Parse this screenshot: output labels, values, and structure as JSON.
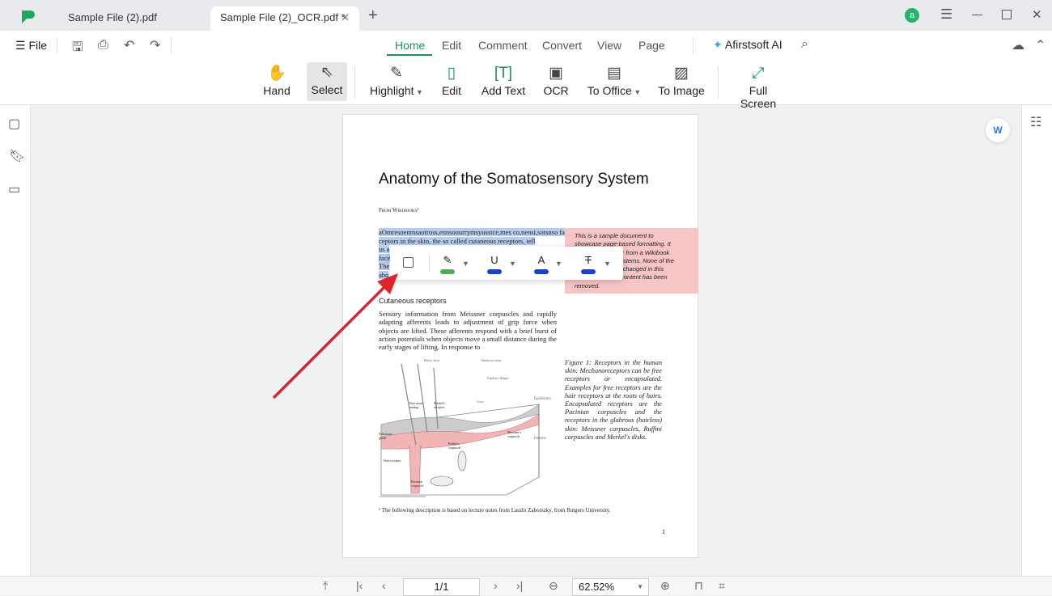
{
  "titlebar": {
    "tabs": [
      {
        "label": "Sample File (2).pdf"
      },
      {
        "label": "Sample File (2)_OCR.pdf *"
      }
    ],
    "avatar_letter": "a",
    "brand_color": "#1ea85a"
  },
  "menu": {
    "file": "File"
  },
  "nav_tabs": [
    "Home",
    "Edit",
    "Comment",
    "Convert",
    "View",
    "Page"
  ],
  "ai": {
    "label": "Afirstsoft AI"
  },
  "tools": [
    {
      "label": "Hand",
      "icon": "hand-icon"
    },
    {
      "label": "Select",
      "icon": "cursor-icon",
      "active": true
    },
    {
      "label": "Highlight",
      "icon": "highlighter-icon"
    },
    {
      "label": "Edit",
      "icon": "edit-icon"
    },
    {
      "label": "Add Text",
      "icon": "add-text-icon"
    },
    {
      "label": "OCR",
      "icon": "ocr-icon"
    },
    {
      "label": "To Office",
      "icon": "office-icon"
    },
    {
      "label": "To Image",
      "icon": "image-icon"
    },
    {
      "label": "Full Screen",
      "icon": "fullscreen-icon"
    }
  ],
  "document": {
    "title": "Anatomy of the Somatosensory System",
    "source": "From Wikibooks¹",
    "selected_lines": [
      "aOmresoenmsaotross,ennsoourrymsyusstce,mes co,nensi,sotsnso fasnc,as oor sn ins t h ceskrein",
      "ceptors in the skin, the so called cutaneous receptors, tell",
      "us a",
      "face",
      "The",
      "abo"
    ],
    "note_lines": [
      "This is a sample document to",
      "showcase page-based formatting. It",
      "contains a chapter from a Wikibook",
      "called Sensory Systems. None of the",
      "content has been changed in this",
      "article, but some content has been",
      "removed."
    ],
    "section": "Cutaneous receptors",
    "paragraph": "Sensory information from Meissner corpuscles and rapidly adapting afferents leads to adjustment of grip force when objects are lifted. These afferents respond with a brief burst of action potentials when objects move a small distance during the early stages of lifting. In response to",
    "figure_labels": {
      "hairy": "Hairy skin",
      "glabrous": "Glabrous skin",
      "papillary": "Papillary Ridges",
      "epidermis": "Epidermis",
      "dermis": "Dermis",
      "free_nerve": "Free nerve ending",
      "merkel": "Merkel's receptor",
      "sebaceous": "Sebaceous gland",
      "ruffini": "Ruffini's corpuscle",
      "meissner": "Meissner's corpuscle",
      "hair_receptor": "Hair receptor",
      "pacinian": "Pacinian corpuscle",
      "septa": "Septa"
    },
    "caption": "Figure 1: Receptors in the human skin: Mechanoreceptors can be free receptors or encapsulated. Examples for free receptors are the hair receptors at the roots of hairs. Encapsulated receptors are the Pacinian corpuscles and the receptors in the glabrous (hairless) skin: Meissner corpuscles, Ruffini corpuscles and Merkel's disks.",
    "footnote": "¹ The following description is based on lecture notes from Laszlo Zaborszky, from Rutgers University.",
    "page_number": "1"
  },
  "popup_colors": {
    "highlight": "#4caf50",
    "underline": "#1a3fcf",
    "text_color": "#1a3fcf",
    "strikethrough": "#1a3fcf"
  },
  "bottom": {
    "page": "1/1",
    "zoom": "62.52%"
  }
}
